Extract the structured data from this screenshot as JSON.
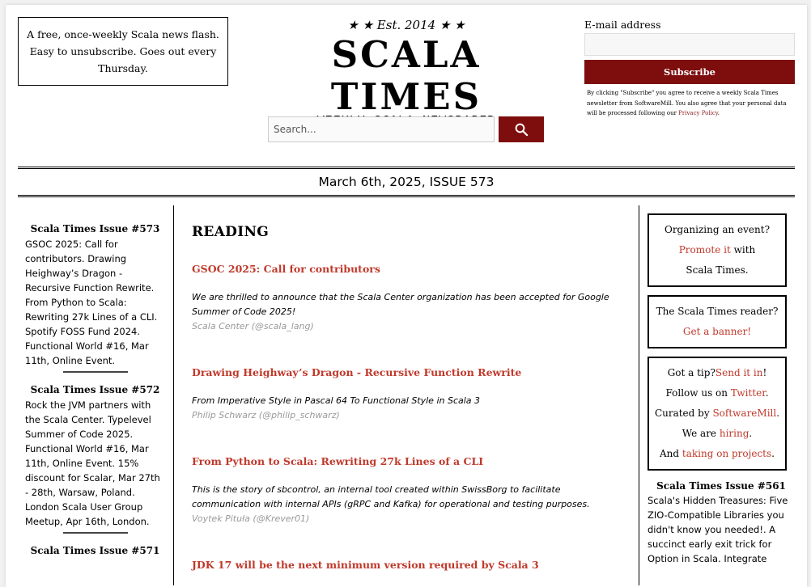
{
  "header": {
    "promo_text": "A free, once-weekly Scala news flash. Easy to unsubscribe. Goes out every Thursday.",
    "tagline": "★ ★ Est. 2014 ★ ★",
    "title": "SCALA TIMES",
    "subtitle": "WEEKLY SCALA NEWSPAPER",
    "search_placeholder": "Search..."
  },
  "signup": {
    "email_label": "E-mail address",
    "email_value": "",
    "subscribe_label": "Subscribe",
    "consent_text": "By clicking \"Subscribe\" you agree to receive a weekly Scala Times newsletter from SoftwareMill. You also agree that your personal data will be processed following our",
    "privacy_link": "Privacy Policy",
    "consent_end": "."
  },
  "issue_bar": "March 6th, 2025, ISSUE 573",
  "sidebar_left": [
    {
      "heading": "Scala Times Issue #573",
      "text": "GSOC 2025: Call for contributors. Drawing Heighway’s Dragon - Recursive Function Rewrite. From Python to Scala: Rewriting 27k Lines of a CLI. Spotify FOSS Fund 2024. Functional World #16, Mar 11th, Online Event."
    },
    {
      "heading": "Scala Times Issue #572",
      "text": "Rock the JVM partners with the Scala Center. Typelevel Summer of Code 2025. Functional World #16, Mar 11th, Online Event. 15% discount for Scalar, Mar 27th - 28th, Warsaw, Poland. London Scala User Group Meetup, Apr 16th, London."
    },
    {
      "heading": "Scala Times Issue #571",
      "text": ""
    }
  ],
  "main": {
    "section": "READING",
    "articles": [
      {
        "title": "GSOC 2025: Call for contributors",
        "desc": "We are thrilled to announce that the Scala Center organization has been accepted for Google Summer of Code 2025!",
        "author": "Scala Center (@scala_lang)"
      },
      {
        "title": "Drawing Heighway’s Dragon - Recursive Function Rewrite",
        "desc": "From Imperative Style in Pascal 64 To Functional Style in Scala 3",
        "author": "Philip Schwarz (@philip_schwarz)"
      },
      {
        "title": "From Python to Scala: Rewriting 27k Lines of a CLI",
        "desc": "This is the story of sbcontrol, an internal tool created within SwissBorg to facilitate communication with internal APIs (gRPC and Kafka) for operational and testing purposes.",
        "author": "Voytek Pituła (@Krever01)"
      },
      {
        "title": "JDK 17 will be the next minimum version required by Scala 3",
        "desc": "",
        "author": ""
      }
    ]
  },
  "sidebar_right": {
    "box1": {
      "line1": "Organizing an event?",
      "link": "Promote it",
      "line2": " with",
      "line3": "Scala Times."
    },
    "box2": {
      "line1": "The Scala Times reader?",
      "link": "Get a banner!"
    },
    "box3": {
      "tip": "Got a tip?",
      "tip_link": "Send it in",
      "tip_end": "!",
      "follow": "Follow us on ",
      "follow_link": "Twitter",
      "follow_end": ".",
      "curated": "Curated by ",
      "curated_link": "SoftwareMill",
      "curated_end": ".",
      "hiring": "We are ",
      "hiring_link": "hiring",
      "hiring_end": ".",
      "and": "And ",
      "and_link": "taking on projects",
      "and_end": "."
    },
    "issue": {
      "heading": "Scala Times Issue #561",
      "text": "Scala's Hidden Treasures: Five ZIO-Compatible Libraries you didn't know you needed!. A succinct early exit trick for Option in Scala. Integrate"
    }
  },
  "colors": {
    "accent": "#7e0e0e",
    "link": "#c0392b",
    "author": "#999999"
  },
  "icons": {
    "search": "search-icon"
  }
}
